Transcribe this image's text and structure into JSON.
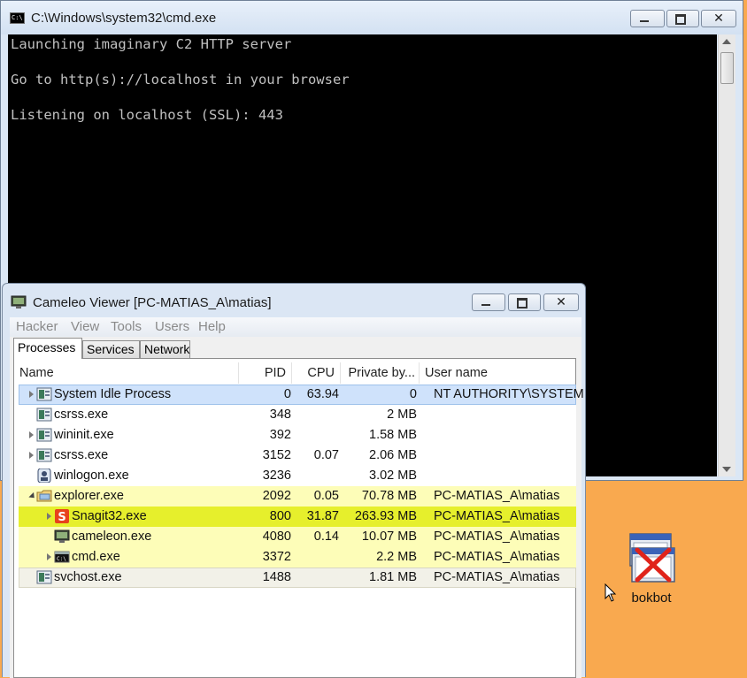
{
  "cmd": {
    "title": "C:\\Windows\\system32\\cmd.exe",
    "icon_text": "C:\\.",
    "lines": [
      "Launching imaginary C2 HTTP server",
      "",
      "Go to http(s)://localhost in your browser",
      "",
      "Listening on localhost (SSL): 443"
    ],
    "close_glyph": "✕"
  },
  "cameleo": {
    "title": "Cameleo Viewer [PC-MATIAS_A\\matias]",
    "close_glyph": "✕",
    "menu": [
      "Hacker",
      "View",
      "Tools",
      "Users",
      "Help"
    ],
    "tabs": [
      "Processes",
      "Services",
      "Network"
    ],
    "active_tab": "Processes",
    "columns": [
      "Name",
      "PID",
      "CPU",
      "Private by...",
      "User name"
    ],
    "rows": [
      {
        "name": "System Idle Process",
        "pid": "0",
        "cpu": "63.94",
        "mem": "0",
        "user": "NT AUTHORITY\\SYSTEM",
        "icon": "service-icon",
        "expand": "closed",
        "indent": 0,
        "bg": "#cfe2fb",
        "border": "#9ec1ea"
      },
      {
        "name": "csrss.exe",
        "pid": "348",
        "cpu": "",
        "mem": "2 MB",
        "user": "",
        "icon": "service-icon",
        "expand": "none",
        "indent": 0,
        "bg": "#ffffff"
      },
      {
        "name": "wininit.exe",
        "pid": "392",
        "cpu": "",
        "mem": "1.58 MB",
        "user": "",
        "icon": "service-icon",
        "expand": "closed",
        "indent": 0,
        "bg": "#ffffff"
      },
      {
        "name": "csrss.exe",
        "pid": "3152",
        "cpu": "0.07",
        "mem": "2.06 MB",
        "user": "",
        "icon": "service-icon",
        "expand": "closed",
        "indent": 0,
        "bg": "#ffffff"
      },
      {
        "name": "winlogon.exe",
        "pid": "3236",
        "cpu": "",
        "mem": "3.02 MB",
        "user": "",
        "icon": "winlogon-icon",
        "expand": "none",
        "indent": 0,
        "bg": "#ffffff"
      },
      {
        "name": "explorer.exe",
        "pid": "2092",
        "cpu": "0.05",
        "mem": "70.78 MB",
        "user": "PC-MATIAS_A\\matias",
        "icon": "folder-icon",
        "expand": "open",
        "indent": 0,
        "bg": "#fdfdb8"
      },
      {
        "name": "Snagit32.exe",
        "pid": "800",
        "cpu": "31.87",
        "mem": "263.93 MB",
        "user": "PC-MATIAS_A\\matias",
        "icon": "snagit-icon",
        "expand": "closed",
        "indent": 1,
        "bg": "#e6ef2c"
      },
      {
        "name": "cameleon.exe",
        "pid": "4080",
        "cpu": "0.14",
        "mem": "10.07 MB",
        "user": "PC-MATIAS_A\\matias",
        "icon": "cameleon-icon",
        "expand": "none",
        "indent": 1,
        "bg": "#fdfdb8"
      },
      {
        "name": "cmd.exe",
        "pid": "3372",
        "cpu": "",
        "mem": "2.2 MB",
        "user": "PC-MATIAS_A\\matias",
        "icon": "cmd-icon",
        "expand": "closed",
        "indent": 1,
        "bg": "#fdfdb8"
      },
      {
        "name": "svchost.exe",
        "pid": "1488",
        "cpu": "",
        "mem": "1.81 MB",
        "user": "PC-MATIAS_A\\matias",
        "icon": "service-icon",
        "expand": "none",
        "indent": 0,
        "bg": "#f2f1e8",
        "border": "#d8d6c4"
      }
    ]
  },
  "desktop": {
    "icon_label": "bokbot"
  },
  "colors": {
    "desktop_bg": "#f9a94f",
    "console_bg": "#000000",
    "console_fg": "#c0c0c0"
  }
}
